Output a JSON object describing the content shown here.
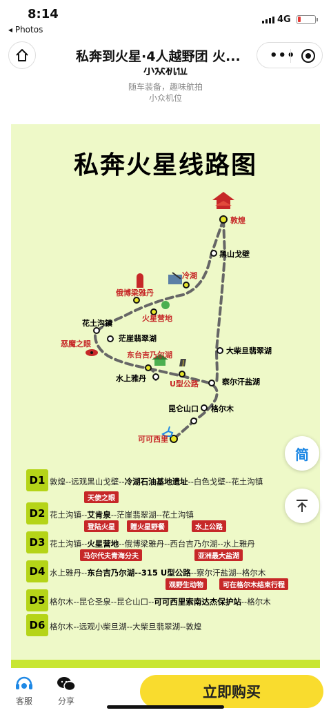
{
  "status_bar": {
    "time": "8:14",
    "back_app": "◂ Photos",
    "network": "4G"
  },
  "nav": {
    "title": "私奔到火星·4人越野团 火...",
    "more_icon": "ellipsis-icon",
    "target_icon": "mini-program-close-icon"
  },
  "intro": {
    "partial_heading": "小众机位",
    "line1": "随车装备，趣味航拍",
    "line2": "小众机位"
  },
  "poster": {
    "title": "私奔火星线路图",
    "bg_color": "#eef9c8",
    "accent_color": "#b5d418",
    "tag_color": "#c62828",
    "map_labels": {
      "dunhuang": "敦煌",
      "heishan": "黑山戈壁",
      "lenghu": "冷湖",
      "eboliang": "俄博梁雅丹",
      "mars_camp": "火星营地",
      "huatugou": "花土沟镇",
      "devil_eye": "恶魔之眼",
      "mangya": "茫崖翡翠湖",
      "dongtai": "东台吉乃尔湖",
      "shuishang": "水上雅丹",
      "u_road": "U型公路",
      "da_chaidan": "大柴旦翡翠湖",
      "chaerhan": "察尔汗盐湖",
      "kunlun": "昆仑山口",
      "golmud": "格尔木",
      "kekexili": "可可西里"
    },
    "days": [
      {
        "badge": "D1",
        "segments": [
          [
            "敦煌--远观黑山戈壁--",
            false
          ],
          [
            "冷湖石油基地遗址",
            true
          ],
          [
            "--白色戈壁--花土沟镇",
            false
          ]
        ],
        "tags": []
      },
      {
        "badge": "D2",
        "segments": [
          [
            "花土沟镇--",
            false
          ],
          [
            "艾肯泉",
            true
          ],
          [
            "--茫崖翡翠湖--花土沟镇",
            false
          ]
        ],
        "tags": [
          "天使之眼"
        ]
      },
      {
        "badge": "D3",
        "segments": [
          [
            "花土沟镇--",
            false
          ],
          [
            "火星营地",
            true
          ],
          [
            "--俄博梁雅丹--西台吉乃尔湖--水上雅丹",
            false
          ]
        ],
        "tags": [
          "登陆火星",
          "赠火星野餐",
          "水上公路"
        ]
      },
      {
        "badge": "D4",
        "segments": [
          [
            "水上雅丹--",
            false
          ],
          [
            "东台吉乃尔湖--315 U型公路",
            true
          ],
          [
            "--察尔汗盐湖--格尔木",
            false
          ]
        ],
        "tags": [
          "马尔代夫青海分夫",
          "亚洲最大盐湖"
        ]
      },
      {
        "badge": "D5",
        "segments": [
          [
            "格尔木--昆仑圣泉--昆仑山口--",
            false
          ],
          [
            "可可西里索南达杰保护站",
            true
          ],
          [
            "--格尔木",
            false
          ]
        ],
        "tags": [
          "观野生动物",
          "可在格尔木结束行程"
        ]
      },
      {
        "badge": "D6",
        "segments": [
          [
            "格尔木--远观小柴旦湖--大柴旦翡翠湖--敦煌",
            false
          ]
        ],
        "tags": []
      }
    ]
  },
  "floating": {
    "simplified_label": "简",
    "top_icon": "arrow-up-icon"
  },
  "bottom_bar": {
    "service_label": "客服",
    "share_label": "分享",
    "buy_label": "立即购买"
  }
}
